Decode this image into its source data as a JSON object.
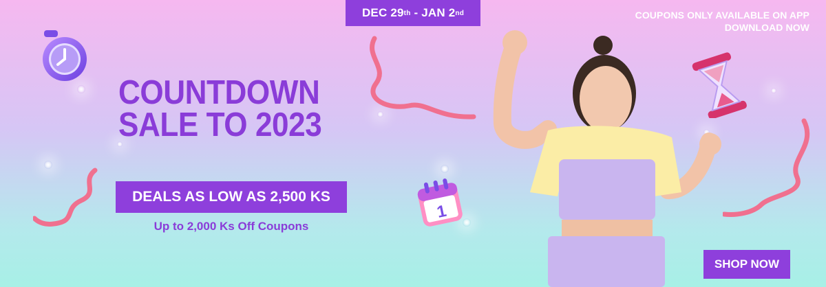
{
  "banner": {
    "date_range": {
      "start": "DEC 29",
      "start_suffix": "th",
      "separator": " - ",
      "end": "JAN 2",
      "end_suffix": "nd"
    },
    "coupon_note": {
      "line1": "COUPONS ONLY AVAILABLE ON APP",
      "line2": "DOWNLOAD NOW"
    },
    "headline": {
      "line1": "COUNTDOWN",
      "line2": "SALE TO 2023"
    },
    "deal_text": "DEALS AS LOW AS 2,500 KS",
    "coupon_text": "Up to 2,000 Ks Off Coupons",
    "shop_button": "SHOP NOW",
    "calendar_day": "1",
    "colors": {
      "accent": "#8e3fdc",
      "headline": "#8a3cd8",
      "ribbon": "#f0708f",
      "bg_top": "#f6b8f0",
      "bg_bottom": "#a7f0e6"
    },
    "icons": [
      "clock-icon",
      "calendar-icon",
      "hourglass-icon",
      "ribbon-streamer-icon",
      "sparkle-icon"
    ]
  }
}
